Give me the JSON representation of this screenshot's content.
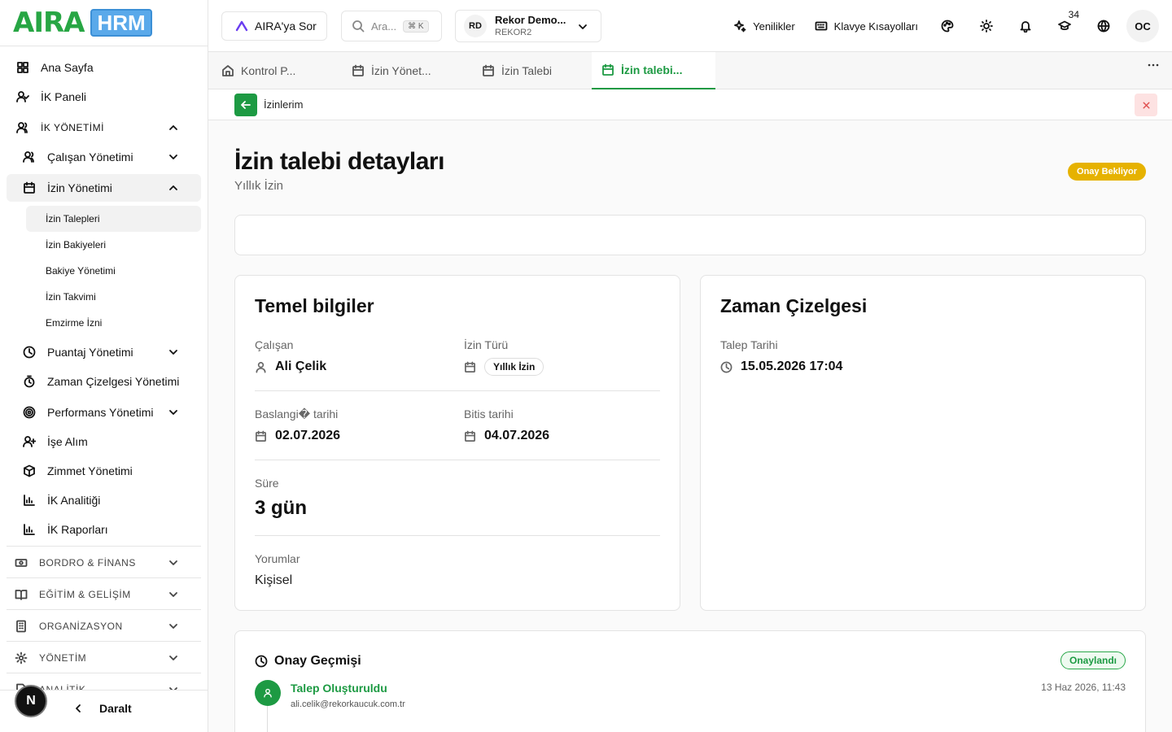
{
  "brand": {
    "logo_text": "AIRA",
    "logo_badge": "HRM",
    "green": "#1d9a43",
    "pending_yellow": "#e6b200"
  },
  "sidebar": {
    "home": "Ana Sayfa",
    "hr_panel": "İK Paneli",
    "hr_management": "İK YÖNETİMİ",
    "employee_mgmt": "Çalışan Yönetimi",
    "leave_mgmt": "İzin Yönetimi",
    "leave_children": [
      "İzin Talepleri",
      "İzin Bakiyeleri",
      "Bakiye Yönetimi",
      "İzin Takvimi",
      "Emzirme İzni"
    ],
    "attendance": "Puantaj Yönetimi",
    "timesheet": "Zaman Çizelgesi Yönetimi",
    "performance": "Performans Yönetimi",
    "recruitment": "İşe Alım",
    "assets": "Zimmet Yönetimi",
    "analytics": "İK Analitiği",
    "reports": "İK Raporları",
    "payroll": "BORDRO & FİNANS",
    "training": "EĞİTİM & GELİŞİM",
    "organization": "ORGANİZASYON",
    "administration": "YÖNETİM",
    "analytics_section": "ANALİTİK",
    "collapse": "Daralt",
    "user_badge": "N"
  },
  "topbar": {
    "ask_label": "AIRA'ya Sor",
    "search_placeholder": "Ara...",
    "search_shortcut": "⌘ K",
    "company_initials": "RD",
    "company_name": "Rekor Demo...",
    "company_code": "REKOR2",
    "whats_new": "Yenilikler",
    "shortcuts": "Klavye Kısayolları",
    "notification_count": "34",
    "user_initials": "OC"
  },
  "tabs": [
    "Kontrol P...",
    "İzin Yönet...",
    "İzin Talebi",
    "İzin talebi..."
  ],
  "breadcrumb": {
    "label": "İzinlerim"
  },
  "page": {
    "title": "İzin talebi detayları",
    "subtitle": "Yıllık İzin",
    "status": "Onay Bekliyor"
  },
  "basic_info": {
    "title": "Temel bilgiler",
    "employee_label": "Çalışan",
    "employee_value": "Ali Çelik",
    "leave_type_label": "İzin Türü",
    "leave_type_value": "Yıllık İzin",
    "start_label": "Baslangi� tarihi",
    "start_value": "02.07.2026",
    "end_label": "Bitis tarihi",
    "end_value": "04.07.2026",
    "duration_label": "Süre",
    "duration_value": "3 gün",
    "comments_label": "Yorumlar",
    "comments_value": "Kişisel"
  },
  "timeline": {
    "title": "Zaman Çizelgesi",
    "request_date_label": "Talep Tarihi",
    "request_date_value": "15.05.2026 17:04"
  },
  "history": {
    "title": "Onay Geçmişi",
    "status": "Onaylandı",
    "entries": [
      {
        "title": "Talep Oluşturuldu",
        "email": "ali.celik@rekorkaucuk.com.tr",
        "date": "13 Haz 2026, 11:43"
      }
    ]
  }
}
